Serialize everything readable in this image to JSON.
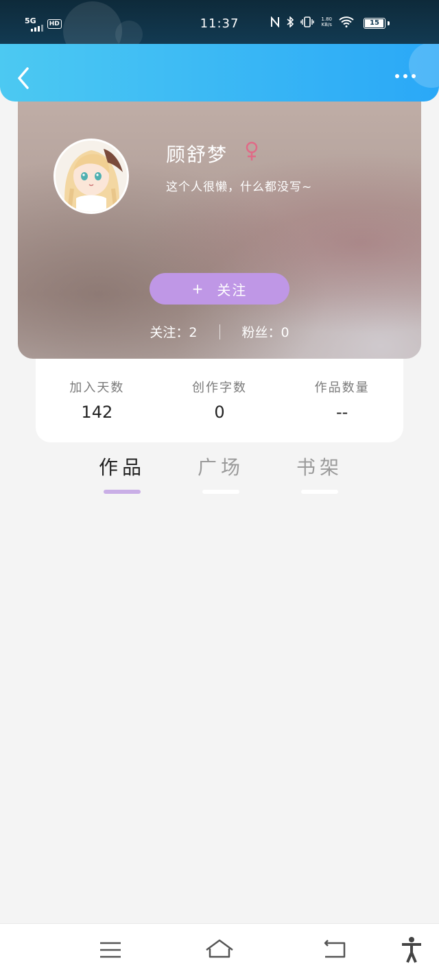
{
  "status_bar": {
    "network": "5G",
    "hd": "HD",
    "time": "11:37",
    "net_speed_value": "1.80",
    "net_speed_unit": "KB/s",
    "battery": "15",
    "icons": [
      "nfc-icon",
      "bluetooth-icon",
      "vibrate-icon",
      "wifi-icon"
    ]
  },
  "header": {
    "back_icon": "chevron-left-icon",
    "more_icon": "more-dots-icon"
  },
  "profile": {
    "username": "顾舒梦",
    "gender": "female",
    "gender_color": "#e06a87",
    "bio": "这个人很懒，什么都没写~",
    "follow_button": {
      "icon": "+",
      "label": "关注"
    },
    "following": "关注：2",
    "followers": "粉丝：0"
  },
  "stats": [
    {
      "label": "加入天数",
      "value": "142"
    },
    {
      "label": "创作字数",
      "value": "0"
    },
    {
      "label": "作品数量",
      "value": "--"
    }
  ],
  "tabs": [
    {
      "label": "作品",
      "active": true
    },
    {
      "label": "广场",
      "active": false
    },
    {
      "label": "书架",
      "active": false
    }
  ],
  "colors": {
    "accent": "#bf97e6",
    "tab_active_text": "#222222",
    "tab_inactive_text": "#9a9a9a",
    "header_start": "#4cc9f2",
    "header_end": "#2aa8f7"
  },
  "bottom_nav": [
    "menu-icon",
    "home-icon",
    "back-icon",
    "accessibility-icon"
  ]
}
